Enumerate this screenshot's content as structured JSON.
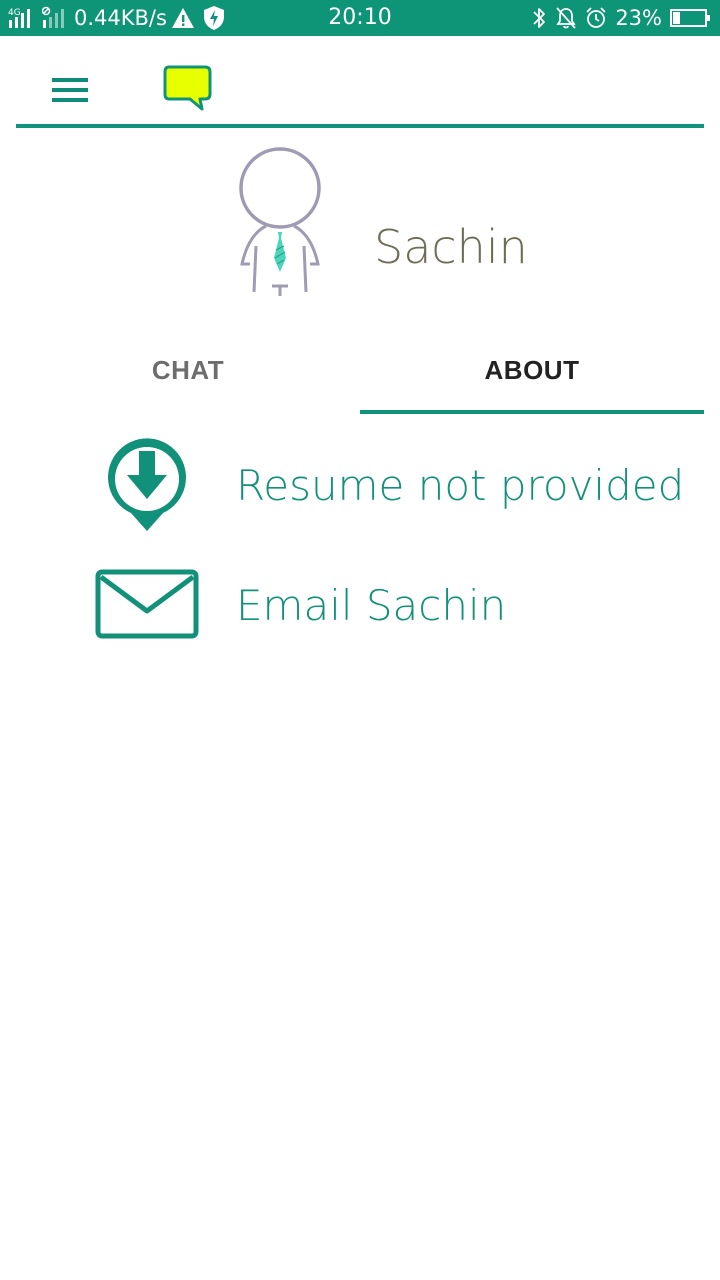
{
  "status_bar": {
    "network_type": "4G",
    "data_speed": "0.44KB/s",
    "time": "20:10",
    "battery_percent": "23%",
    "battery_level": 0.23,
    "icons": [
      "signal-icon",
      "signal-icon",
      "warning-icon",
      "shield-icon",
      "bluetooth-icon",
      "bell-off-icon",
      "alarm-icon",
      "battery-icon"
    ]
  },
  "app_bar": {
    "icons": [
      "menu-icon",
      "chat-bubble-icon"
    ],
    "accent_color": "#10937b",
    "logo_color": "#e8ff00"
  },
  "profile": {
    "name": "Sachin",
    "avatar_icon": "person-with-tie-icon"
  },
  "tabs": [
    {
      "label": "CHAT",
      "selected": false
    },
    {
      "label": "ABOUT",
      "selected": true
    }
  ],
  "about": {
    "items": [
      {
        "icon": "download-pin-icon",
        "label": "Resume not provided"
      },
      {
        "icon": "email-icon",
        "label": "Email Sachin"
      }
    ]
  }
}
